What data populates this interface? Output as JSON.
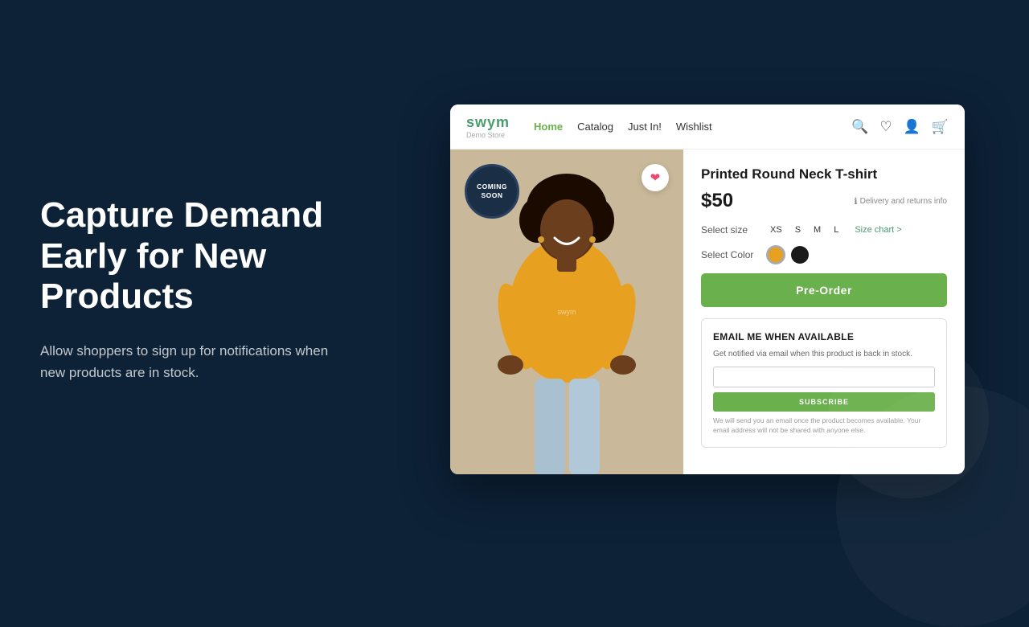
{
  "background": {
    "color": "#0d2137"
  },
  "left": {
    "headline": "Capture Demand Early for New Products",
    "description": "Allow shoppers to sign up for notifications when new products are in stock."
  },
  "store": {
    "nav": {
      "logo_text": "swym",
      "logo_sub": "Demo Store",
      "links": [
        {
          "label": "Home",
          "active": true
        },
        {
          "label": "Catalog",
          "active": false
        },
        {
          "label": "Just In!",
          "active": false
        },
        {
          "label": "Wishlist",
          "active": false
        }
      ],
      "icons": [
        "search",
        "heart",
        "user",
        "cart"
      ]
    },
    "product": {
      "badge_line1": "COMING",
      "badge_line2": "SOON",
      "title": "Printed Round Neck T-shirt",
      "price": "$50",
      "delivery_label": "Delivery and returns info",
      "size_label": "Select size",
      "sizes": [
        "XS",
        "S",
        "M",
        "L"
      ],
      "size_chart": "Size chart >",
      "color_label": "Select Color",
      "colors": [
        {
          "hex": "#e8a020",
          "selected": true
        },
        {
          "hex": "#1a1a1a",
          "selected": false
        }
      ],
      "pre_order_btn": "Pre-Order",
      "email_section": {
        "title": "EMAIL ME WHEN AVAILABLE",
        "description": "Get notified via email when this product is back in stock.",
        "input_placeholder": "",
        "subscribe_btn": "SUBSCRIBE",
        "privacy": "We will send you an email once the product becomes available. Your email address will not be shared with anyone else."
      }
    }
  }
}
